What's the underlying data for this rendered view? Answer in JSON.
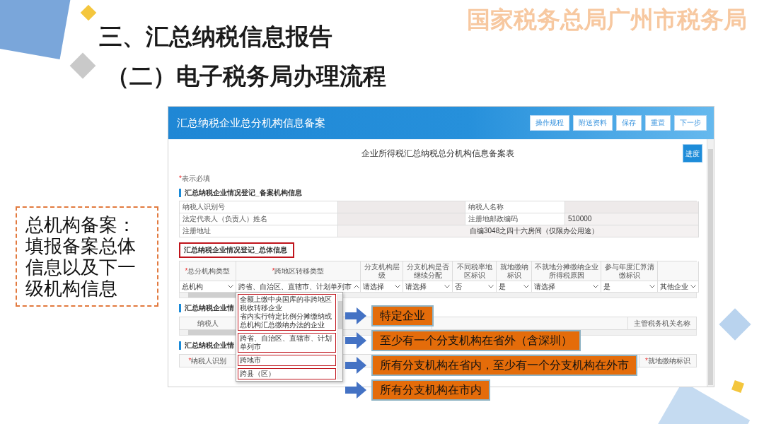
{
  "slide": {
    "banner": "国家税务总局广州市税务局",
    "title": "三、汇总纳税信息报告",
    "subtitle": "（二）电子税务局办理流程"
  },
  "note": "总机构备案：填报备案总体信息以及下一级机构信息",
  "app": {
    "title": "汇总纳税企业总分机构信息备案",
    "buttons": [
      "操作规程",
      "附送资料",
      "保存",
      "重置",
      "下一步"
    ],
    "form_title": "企业所得税汇总纳税总分机构信息备案表",
    "progress_button": "进度",
    "required_note": {
      "mark": "*",
      "text": "表示必填"
    },
    "sections": [
      {
        "kind": "info",
        "heading": "汇总纳税企业情况登记_备案机构信息",
        "highlighted": false,
        "rows": [
          [
            {
              "kind": "label",
              "text": "纳税人识别号"
            },
            {
              "kind": "blank"
            },
            {
              "kind": "label",
              "text": "纳税人名称"
            },
            {
              "kind": "blank"
            }
          ],
          [
            {
              "kind": "label",
              "text": "法定代表人（负责人）姓名"
            },
            {
              "kind": "blank"
            },
            {
              "kind": "label",
              "text": "注册地邮政编码"
            },
            {
              "kind": "value",
              "text": "510000"
            }
          ],
          [
            {
              "kind": "label",
              "text": "注册地址"
            },
            {
              "kind": "value",
              "text": "自编3048之四十六房间（仅限办公用途）"
            }
          ]
        ]
      },
      {
        "kind": "grid",
        "heading": "汇总纳税企业情况登记_总体信息",
        "highlighted": true,
        "columns": [
          {
            "mark": "*",
            "label": "总分机构类型"
          },
          {
            "mark": "*",
            "label": "跨地区转移类型"
          },
          {
            "label": "分支机构层级"
          },
          {
            "label": "分支机构是否继续分配"
          },
          {
            "label": "不同税率地区标识"
          },
          {
            "label": "就地缴纳标识"
          },
          {
            "label": "不就地分摊缴纳企业所得税原因"
          },
          {
            "label": "参与年度汇算清缴标识"
          }
        ],
        "cells": [
          {
            "text": "总机构",
            "expanded": false
          },
          {
            "text": "跨省、自治区、直辖市、计划单列市",
            "expanded": true,
            "dropdown": {
              "groups": [
                {
                  "highlighted": true,
                  "options": [
                    "全额上缴中央国库的非跨地区税收转移企业",
                    "省内实行特定比例分摊缴纳或总机构汇总缴纳办法的企业"
                  ]
                },
                {
                  "highlighted": true,
                  "options": [
                    "跨省、自治区、直辖市、计划单列市"
                  ]
                },
                {
                  "highlighted": true,
                  "options": [
                    "跨地市"
                  ]
                },
                {
                  "highlighted": true,
                  "options": [
                    "跨县（区）"
                  ]
                }
              ]
            }
          },
          {
            "text": "请选择",
            "expanded": false
          },
          {
            "text": "请选择",
            "expanded": false
          },
          {
            "text": "否",
            "expanded": false
          },
          {
            "text": "是",
            "expanded": false
          },
          {
            "text": "请选择",
            "expanded": false
          },
          {
            "text": "是",
            "expanded": false
          },
          {
            "text": "其他企业",
            "expanded": false
          }
        ]
      },
      {
        "kind": "list",
        "heading": "汇总纳税企业情",
        "highlighted": false,
        "columns": [
          {
            "label": "纳税人"
          },
          {
            "label": "主管税务机关名称"
          }
        ]
      },
      {
        "kind": "list",
        "heading": "汇总纳税企业情",
        "highlighted": false,
        "columns": [
          {
            "mark": "*",
            "label": "纳税人识别"
          },
          {
            "mark": "*",
            "label": "就地缴纳标识"
          }
        ]
      }
    ]
  },
  "callouts": [
    "特定企业",
    "至少有一个分支机构在省外（含深圳）",
    "所有分支机构在省内，至少有一个分支机构在外市",
    "所有分支机构在市内"
  ]
}
